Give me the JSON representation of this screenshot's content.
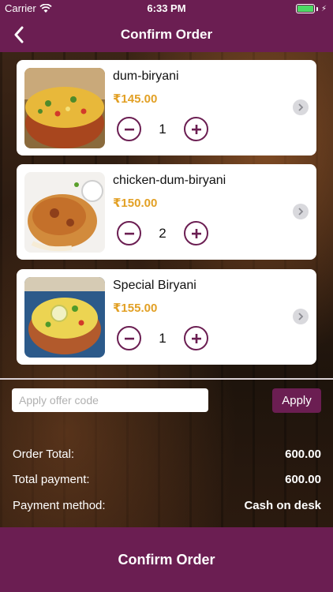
{
  "status_bar": {
    "carrier": "Carrier",
    "time": "6:33 PM"
  },
  "nav": {
    "title": "Confirm Order"
  },
  "items": [
    {
      "name": "dum-biryani",
      "price": "₹145.00",
      "qty": "1"
    },
    {
      "name": "chicken-dum-biryani",
      "price": "₹150.00",
      "qty": "2"
    },
    {
      "name": "Special Biryani",
      "price": "₹155.00",
      "qty": "1"
    }
  ],
  "offer": {
    "placeholder": "Apply offer code",
    "apply_label": "Apply"
  },
  "summary": {
    "order_total_label": "Order Total:",
    "order_total_value": "600.00",
    "total_payment_label": "Total payment:",
    "total_payment_value": "600.00",
    "payment_method_label": "Payment method:",
    "payment_method_value": "Cash on desk"
  },
  "confirm_label": "Confirm Order",
  "colors": {
    "brand": "#6b1e52",
    "price": "#e2a025",
    "battery": "#4cd964"
  }
}
